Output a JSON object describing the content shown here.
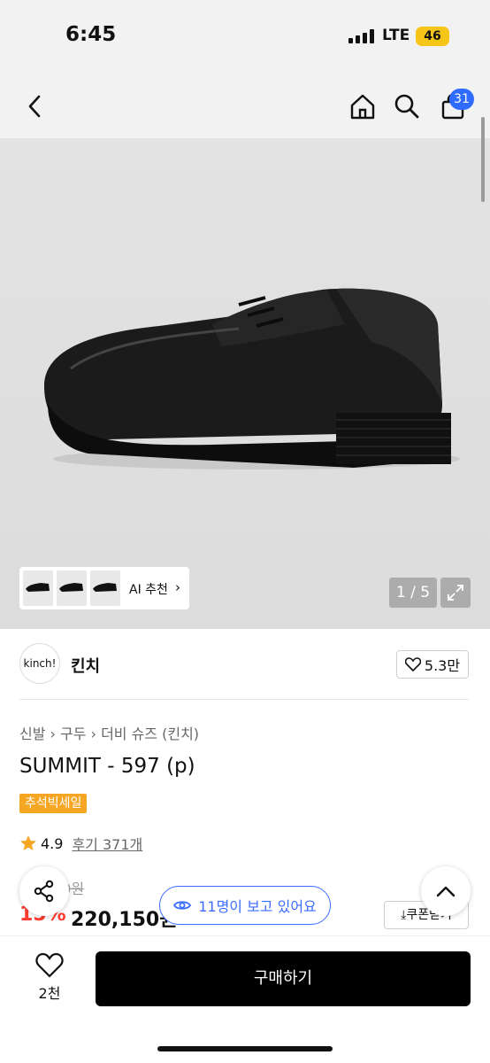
{
  "status": {
    "time": "6:45",
    "network": "LTE",
    "battery": "46"
  },
  "nav": {
    "cart_count": "31"
  },
  "gallery": {
    "ai_label": "AI 추천",
    "pager": "1 / 5"
  },
  "brand": {
    "logo_text": "kinch!",
    "name": "킨치",
    "likes": "5.3만"
  },
  "product": {
    "breadcrumb": [
      "신발",
      "구두",
      "더비 슈즈 (킨치)"
    ],
    "title": "SUMMIT - 597 (p)",
    "sale_badge": "추석빅세일",
    "rating": "4.9",
    "reviews": "후기 371개",
    "original_price": "00원",
    "discount": "15%",
    "price": "220,150원"
  },
  "floating": {
    "viewers": "11명이 보고 있어요",
    "coupon": "쿠폰받기"
  },
  "bottom": {
    "like_count": "2천",
    "buy_label": "구매하기"
  },
  "colors": {
    "accent": "#3b6cff",
    "discount": "#ff3b2f",
    "badge": "#f5a623",
    "buy": "#000000"
  }
}
